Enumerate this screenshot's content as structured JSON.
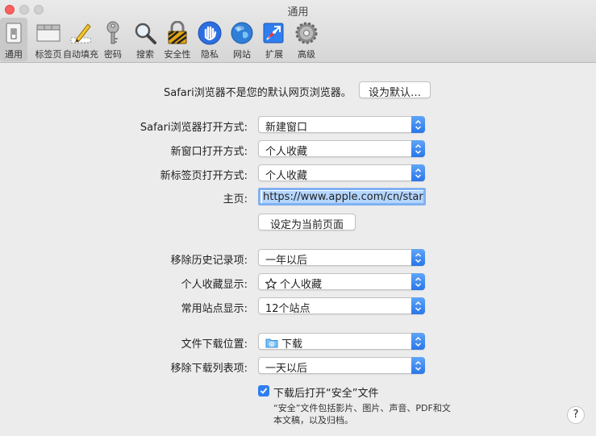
{
  "window": {
    "title": "通用"
  },
  "toolbar": {
    "tabs": [
      {
        "label": "通用",
        "icon": "general-icon",
        "active": true
      },
      {
        "label": "标签页",
        "icon": "tabs-icon"
      },
      {
        "label": "自动填充",
        "icon": "autofill-icon"
      },
      {
        "label": "密码",
        "icon": "key-icon"
      },
      {
        "label": "搜索",
        "icon": "search-icon"
      },
      {
        "label": "安全性",
        "icon": "lock-icon"
      },
      {
        "label": "隐私",
        "icon": "hand-icon"
      },
      {
        "label": "网站",
        "icon": "globe-icon"
      },
      {
        "label": "扩展",
        "icon": "extension-icon"
      },
      {
        "label": "高级",
        "icon": "gear-icon"
      }
    ]
  },
  "default_browser": {
    "text": "Safari浏览器不是您的默认网页浏览器。",
    "button": "设为默认…"
  },
  "settings": {
    "open_with": {
      "label": "Safari浏览器打开方式:",
      "value": "新建窗口"
    },
    "new_window": {
      "label": "新窗口打开方式:",
      "value": "个人收藏"
    },
    "new_tab": {
      "label": "新标签页打开方式:",
      "value": "个人收藏"
    },
    "homepage": {
      "label": "主页:",
      "value": "https://www.apple.com/cn/startpage/",
      "button": "设定为当前页面"
    },
    "remove_history": {
      "label": "移除历史记录项:",
      "value": "一年以后"
    },
    "favorites_shows": {
      "label": "个人收藏显示:",
      "value": "个人收藏"
    },
    "top_sites": {
      "label": "常用站点显示:",
      "value": "12个站点"
    },
    "download_location": {
      "label": "文件下载位置:",
      "value": "下载"
    },
    "remove_downloads": {
      "label": "移除下载列表项:",
      "value": "一天以后"
    },
    "open_safe": {
      "label": "下载后打开“安全”文件",
      "checked": true,
      "note_line1": "“安全”文件包括影片、图片、声音、PDF和文",
      "note_line2": "本文稿，以及归档。"
    }
  },
  "help": {
    "label": "?"
  },
  "colors": {
    "accent": "#2f7ef0",
    "close": "#fc605c"
  }
}
